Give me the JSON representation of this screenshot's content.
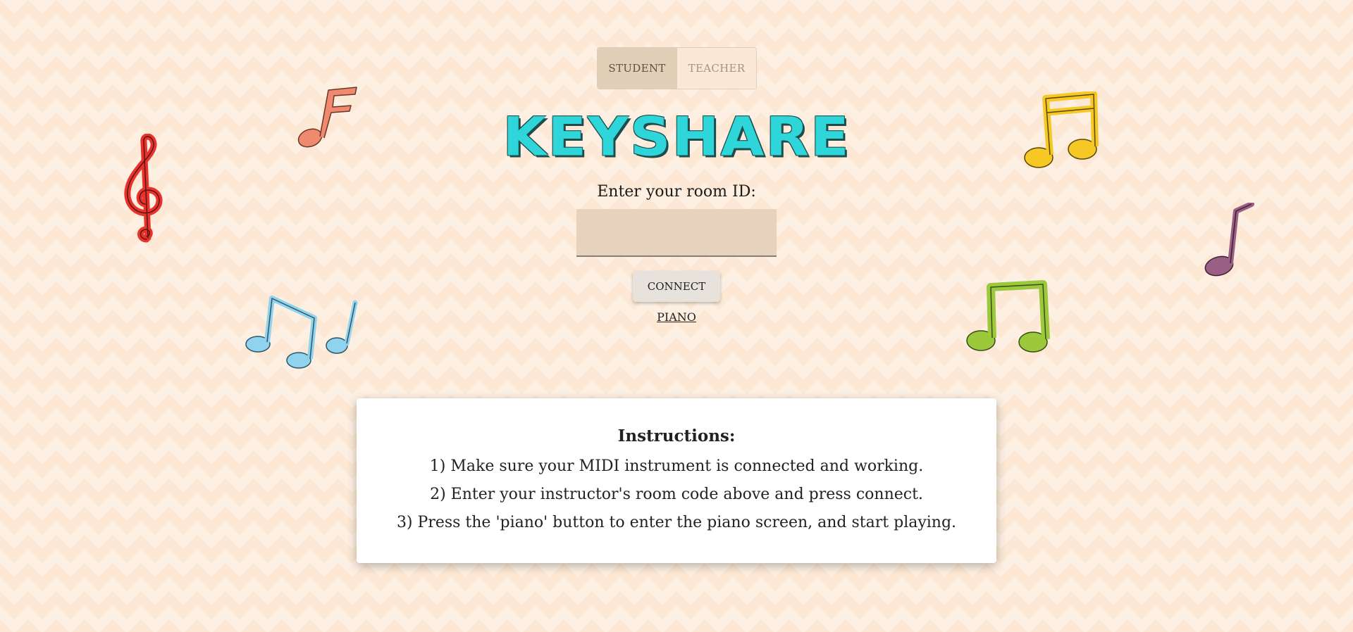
{
  "mode_toggle": {
    "student_label": "STUDENT",
    "teacher_label": "TEACHER",
    "selected": "STUDENT"
  },
  "logo": {
    "text": "KEYSHARE"
  },
  "room": {
    "label": "Enter your room ID:",
    "value": "",
    "connect_label": "CONNECT",
    "piano_link": "PIANO"
  },
  "instructions": {
    "title": "Instructions:",
    "steps": [
      "1) Make sure your MIDI instrument is connected and working.",
      "2) Enter your instructor's room code above and press connect.",
      "3) Press the 'piano' button to enter the piano screen, and start playing."
    ]
  },
  "decorations": {
    "icons": [
      "treble-clef-icon",
      "flag-note-icon",
      "beamed-notes-icon",
      "eighth-notes-icon",
      "quarter-note-icon"
    ],
    "colors": {
      "red": "#e8332c",
      "salmon": "#f08a6e",
      "blue": "#8fd3ef",
      "yellow": "#f5c823",
      "green": "#9cc83c",
      "purple": "#9b5f86",
      "logo": "#2fd6d9"
    }
  }
}
